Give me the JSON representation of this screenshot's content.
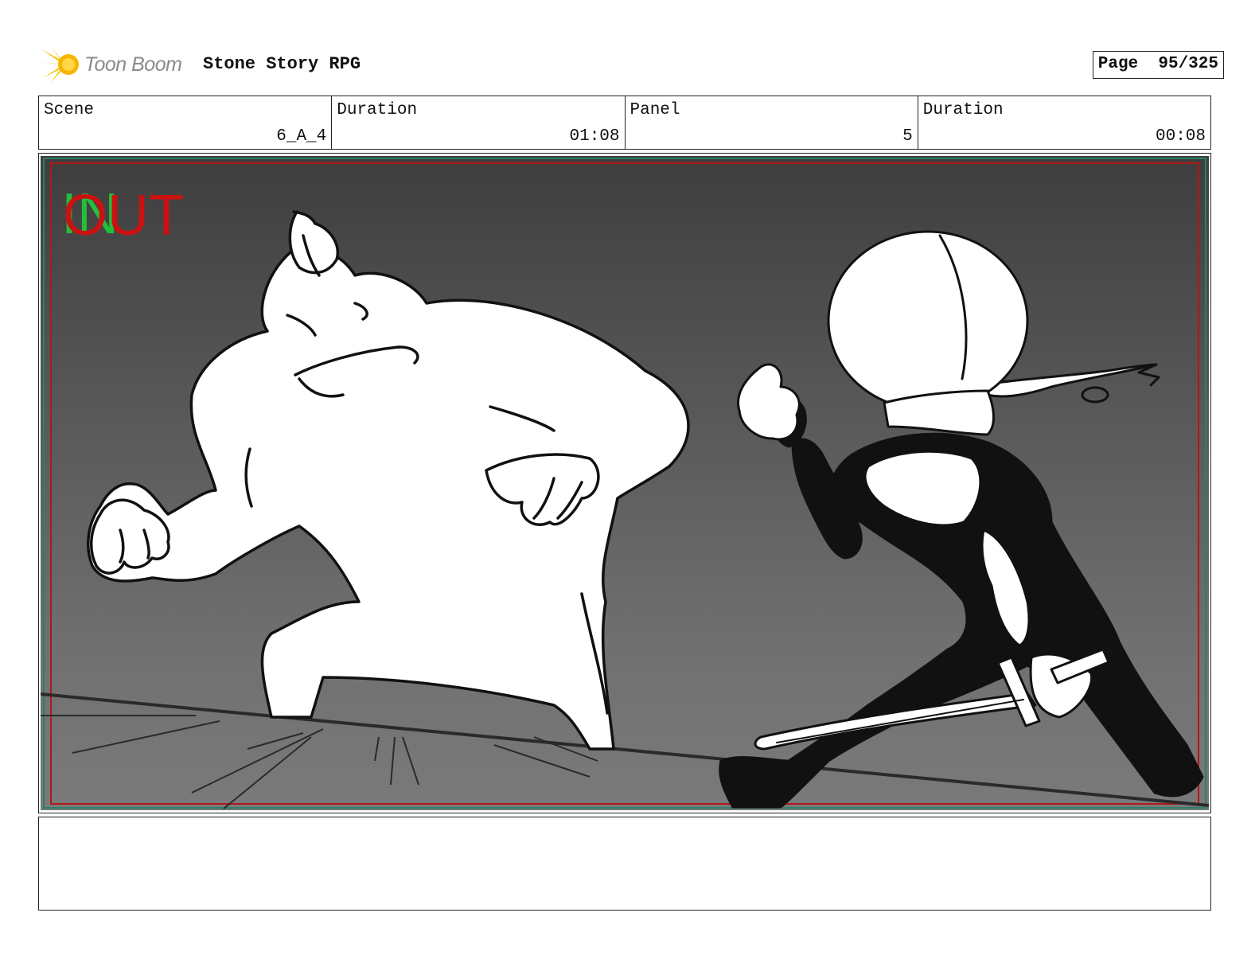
{
  "header": {
    "brand": "Toon Boom",
    "project_title": "Stone Story RPG",
    "page_label": "Page",
    "page_number": "95/325"
  },
  "info": {
    "scene_label": "Scene",
    "scene_value": "6_A_4",
    "duration_label": "Duration",
    "duration_value": "01:08",
    "panel_label": "Panel",
    "panel_value": "5",
    "panel_duration_label": "Duration",
    "panel_duration_value": "00:08"
  },
  "panel": {
    "in_marker": "IN",
    "out_marker": "OUT",
    "in_color": "#22c03a",
    "out_color": "#cc1111"
  },
  "notes": {
    "text": ""
  }
}
